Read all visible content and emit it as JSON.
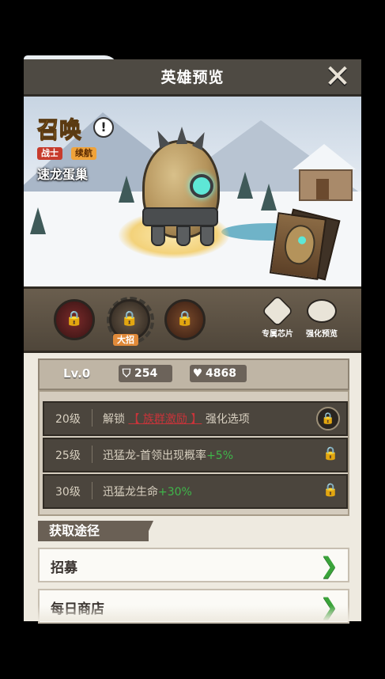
{
  "header": {
    "title": "英雄预览",
    "close_icon": "close-icon"
  },
  "hero": {
    "summon_label": "召唤",
    "tags": [
      "战士",
      "续航"
    ],
    "name": "速龙蛋巢"
  },
  "skills": {
    "ultimate_label": "大招",
    "exclusive_chip_label": "专属芯片",
    "enhance_preview_label": "强化预览"
  },
  "stats": {
    "level": "Lv.0",
    "defense": "254",
    "hp": "4868"
  },
  "unlocks": [
    {
      "level": "20级",
      "prefix": "解锁",
      "link": "【 族群激励 】",
      "suffix": "强化选项",
      "bonus": ""
    },
    {
      "level": "25级",
      "prefix": "迅猛龙-首领出现概率",
      "link": "",
      "suffix": "",
      "bonus": "+5%"
    },
    {
      "level": "30级",
      "prefix": "迅猛龙生命",
      "link": "",
      "suffix": "",
      "bonus": "+30%"
    }
  ],
  "sources": {
    "title": "获取途径",
    "items": [
      "招募",
      "每日商店"
    ]
  },
  "colors": {
    "accent_gold": "#f6b33a",
    "bonus_green": "#3fb64a",
    "link_red": "#c8343a",
    "chevron_green": "#3aa33a"
  }
}
